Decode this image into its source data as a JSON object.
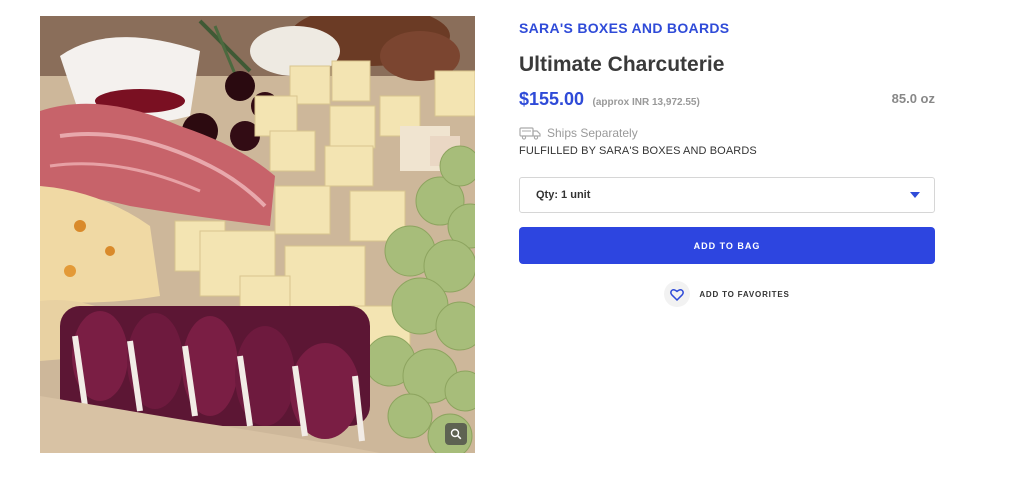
{
  "product": {
    "vendor": "SARA'S BOXES AND BOARDS",
    "title": "Ultimate Charcuterie",
    "price": "$155.00",
    "approx_price": "(approx INR 13,972.55)",
    "weight": "85.0 oz",
    "shipping_note": "Ships Separately",
    "fulfilled_by": "FULFILLED BY SARA'S BOXES AND BOARDS",
    "quantity_selected": "Qty: 1 unit",
    "add_to_bag_label": "ADD TO BAG",
    "add_to_favorites_label": "ADD TO FAVORITES"
  },
  "image": {
    "description_icon": "zoom-icon"
  },
  "colors": {
    "accent": "#2f4bd8",
    "button": "#2d45e0",
    "title": "#3a3a3a",
    "muted": "#999999"
  }
}
